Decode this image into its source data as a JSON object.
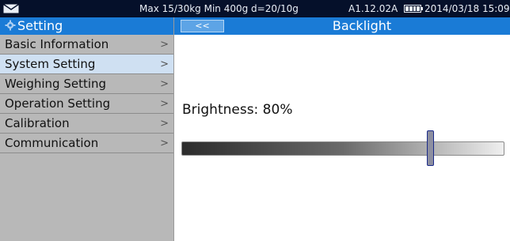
{
  "status_bar": {
    "specs": "Max 15/30kg  Min 400g  d=20/10g",
    "firmware": "A1.12.02A",
    "datetime": "2014/03/18  15:09",
    "battery_icon": "battery-icon",
    "mail_icon": "mail-icon"
  },
  "sidebar": {
    "title": "Setting",
    "items": [
      {
        "label": "Basic Information",
        "chevron": ">"
      },
      {
        "label": "System Setting",
        "chevron": ">"
      },
      {
        "label": "Weighing Setting",
        "chevron": ">"
      },
      {
        "label": "Operation Setting",
        "chevron": ">"
      },
      {
        "label": "Calibration",
        "chevron": ">"
      },
      {
        "label": "Communication",
        "chevron": ">"
      }
    ],
    "selected_index": 1
  },
  "main": {
    "back_label": "<<",
    "title": "Backlight",
    "brightness_label": "Brightness: 80%",
    "brightness_value": 0.8
  },
  "colors": {
    "status_bar_bg": "#05102a",
    "header_blue": "#1a7bd6",
    "sidebar_bg": "#b8b8b8",
    "selected_item_bg": "#cfe0f2"
  }
}
